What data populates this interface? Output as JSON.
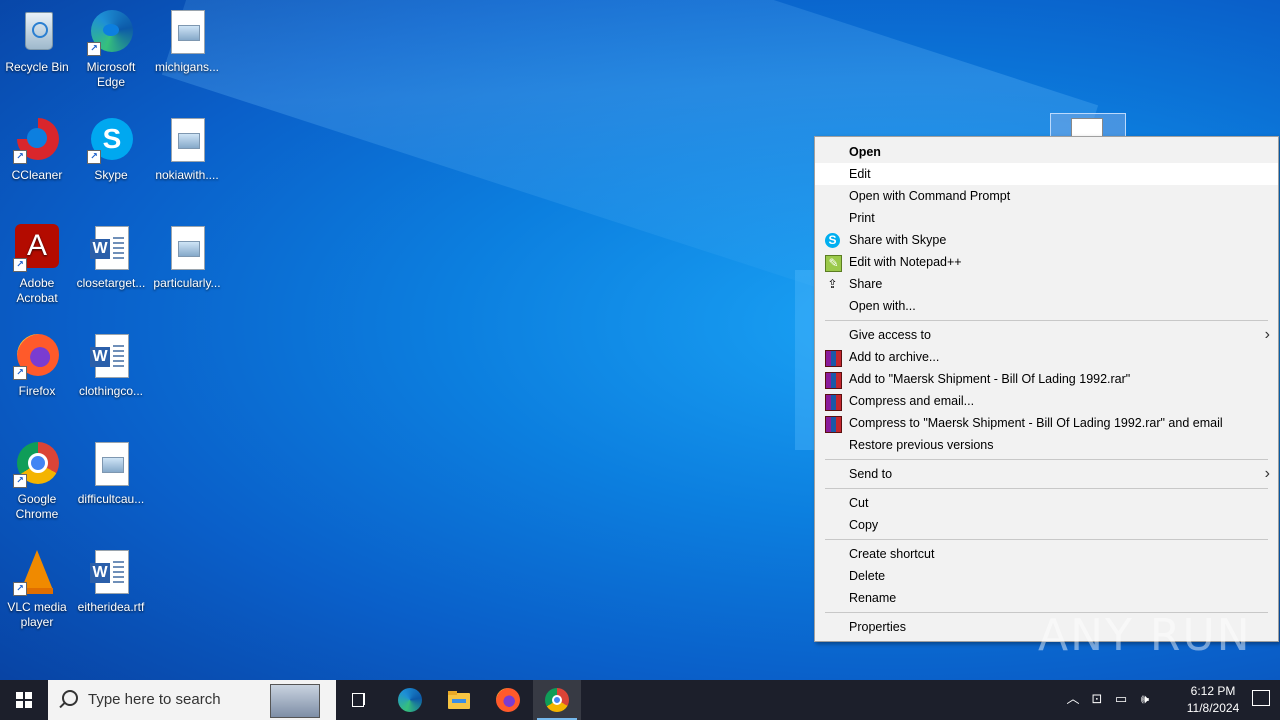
{
  "desktop": {
    "icons": [
      {
        "label": "Recycle Bin",
        "icon": "recycle-bin-icon"
      },
      {
        "label": "Microsoft Edge",
        "icon": "edge-icon"
      },
      {
        "label": "michigans...",
        "icon": "image-file-icon"
      },
      {
        "label": "CCleaner",
        "icon": "ccleaner-icon"
      },
      {
        "label": "Skype",
        "icon": "skype-icon"
      },
      {
        "label": "nokiawith....",
        "icon": "image-file-icon"
      },
      {
        "label": "Adobe Acrobat",
        "icon": "acrobat-icon"
      },
      {
        "label": "closetarget...",
        "icon": "word-doc-icon"
      },
      {
        "label": "particularly...",
        "icon": "image-file-icon"
      },
      {
        "label": "Firefox",
        "icon": "firefox-icon"
      },
      {
        "label": "clothingco...",
        "icon": "word-doc-icon"
      },
      {
        "label": "Google Chrome",
        "icon": "chrome-icon"
      },
      {
        "label": "difficultcau...",
        "icon": "image-file-icon"
      },
      {
        "label": "VLC media player",
        "icon": "vlc-icon"
      },
      {
        "label": "eitheridea.rtf",
        "icon": "word-doc-icon"
      }
    ]
  },
  "context_menu": {
    "items": [
      {
        "label": "Open",
        "bold": true
      },
      {
        "label": "Edit",
        "hover": true
      },
      {
        "label": "Open with Command Prompt"
      },
      {
        "label": "Print"
      },
      {
        "label": "Share with Skype",
        "icon": "skype-icon"
      },
      {
        "label": "Edit with Notepad++",
        "icon": "notepad-plus-plus-icon"
      },
      {
        "label": "Share",
        "icon": "share-icon"
      },
      {
        "label": "Open with..."
      },
      {
        "label": "Give access to",
        "submenu": true
      },
      {
        "label": "Add to archive...",
        "icon": "winrar-icon"
      },
      {
        "label": "Add to \"Maersk Shipment - Bill Of Lading 1992.rar\"",
        "icon": "winrar-icon"
      },
      {
        "label": "Compress and email...",
        "icon": "winrar-icon"
      },
      {
        "label": "Compress to \"Maersk Shipment - Bill Of Lading 1992.rar\" and email",
        "icon": "winrar-icon"
      },
      {
        "label": "Restore previous versions"
      },
      {
        "label": "Send to",
        "submenu": true
      },
      {
        "label": "Cut"
      },
      {
        "label": "Copy"
      },
      {
        "label": "Create shortcut"
      },
      {
        "label": "Delete"
      },
      {
        "label": "Rename"
      },
      {
        "label": "Properties"
      }
    ]
  },
  "watermark": "ANY RUN",
  "taskbar": {
    "search_placeholder": "Type here to search",
    "apps": [
      "task-view-icon",
      "edge-icon",
      "file-explorer-icon",
      "firefox-icon",
      "chrome-icon"
    ],
    "clock_time": "6:12 PM",
    "clock_date": "11/8/2024"
  },
  "colors": {
    "desktop_bg": "#0c7fdf",
    "taskbar_bg": "#1c1f2b",
    "menu_bg": "#f2f2f2",
    "menu_hover": "#ffffff"
  }
}
